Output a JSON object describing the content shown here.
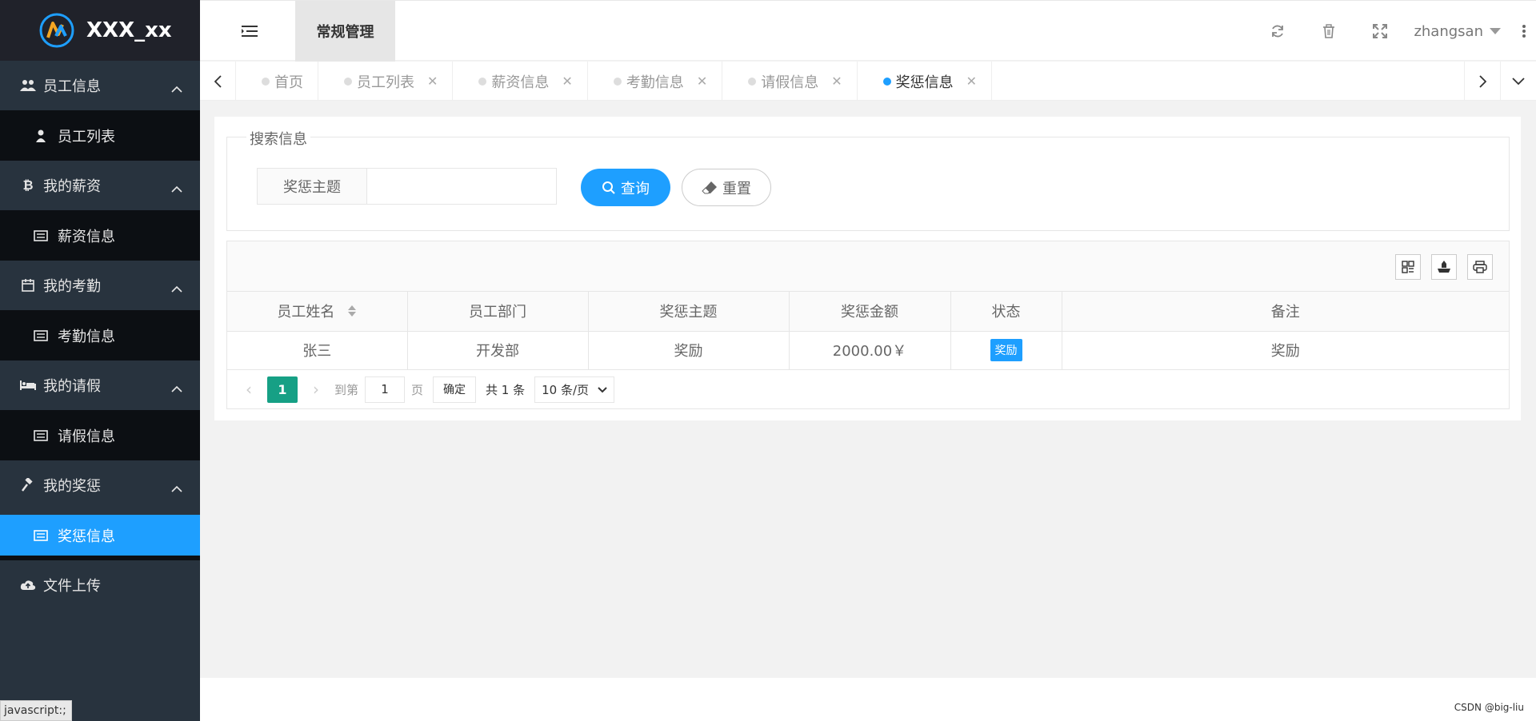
{
  "app": {
    "logo_text": "XXX_xx"
  },
  "header": {
    "nav_label": "常规管理",
    "username": "zhangsan"
  },
  "sidebar": {
    "groups": [
      {
        "label": "员工信息",
        "icon": "users-icon",
        "child": "员工列表",
        "child_icon": "user-icon"
      },
      {
        "label": "我的薪资",
        "icon": "bitcoin-icon",
        "child": "薪资信息",
        "child_icon": "list-icon"
      },
      {
        "label": "我的考勤",
        "icon": "calendar-icon",
        "child": "考勤信息",
        "child_icon": "list-icon"
      },
      {
        "label": "我的请假",
        "icon": "bed-icon",
        "child": "请假信息",
        "child_icon": "list-icon"
      },
      {
        "label": "我的奖惩",
        "icon": "gavel-icon",
        "child": "奖惩信息",
        "child_icon": "list-icon"
      },
      {
        "label": "文件上传",
        "icon": "cloud-upload-icon"
      }
    ]
  },
  "tabs": [
    "首页",
    "员工列表",
    "薪资信息",
    "考勤信息",
    "请假信息",
    "奖惩信息"
  ],
  "active_tab": "奖惩信息",
  "search": {
    "legend": "搜索信息",
    "label": "奖惩主题",
    "value": "",
    "query_button": "查询",
    "reset_button": "重置"
  },
  "table": {
    "columns": [
      "员工姓名",
      "员工部门",
      "奖惩主题",
      "奖惩金额",
      "状态",
      "备注"
    ],
    "rows": [
      {
        "name": "张三",
        "dept": "开发部",
        "topic": "奖励",
        "amount": "2000.00￥",
        "status": "奖励",
        "remark": "奖励"
      }
    ]
  },
  "pager": {
    "current": "1",
    "goto_label": "到第",
    "page_value": "1",
    "page_unit": "页",
    "confirm": "确定",
    "total": "共 1 条",
    "page_size": "10 条/页"
  },
  "status_bar": "javascript:;",
  "watermark": "CSDN @big-liu",
  "colors": {
    "accent": "#1e9fff",
    "sidebar": "#28333e",
    "pager_active": "#16a085"
  }
}
